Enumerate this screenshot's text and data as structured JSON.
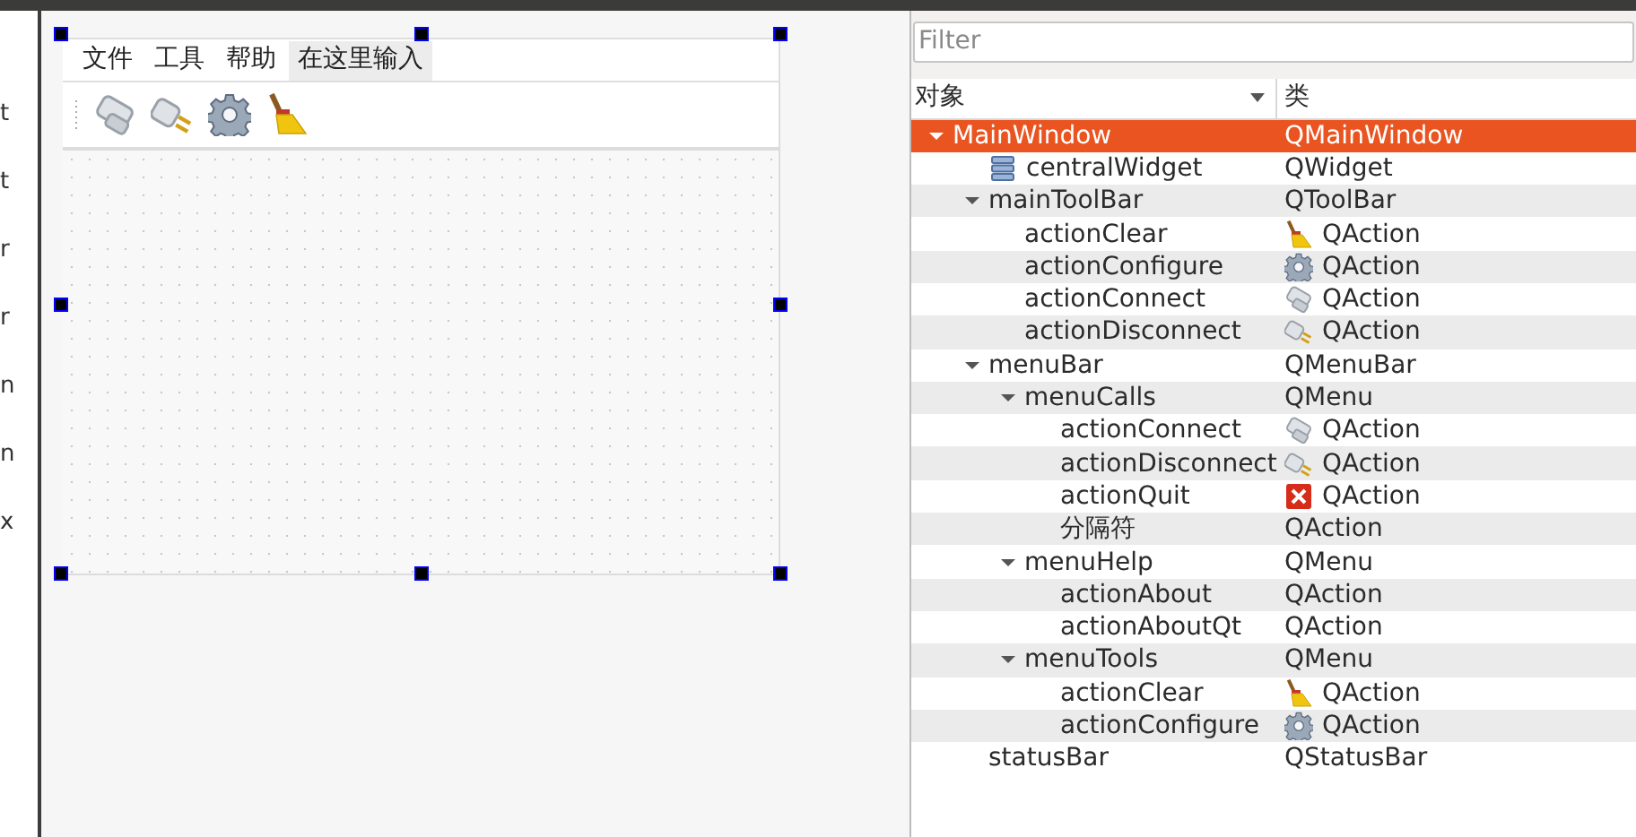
{
  "left_panel": {
    "fragments": [
      "t",
      "t",
      "r",
      "r",
      "n",
      "n",
      "x"
    ]
  },
  "form": {
    "menu_items": [
      {
        "label": "文件",
        "kind": "menu"
      },
      {
        "label": "工具",
        "kind": "menu"
      },
      {
        "label": "帮助",
        "kind": "menu"
      },
      {
        "label": "在这里输入",
        "kind": "placeholder"
      }
    ],
    "toolbar_actions": [
      {
        "kind": "connect"
      },
      {
        "kind": "disconnect"
      },
      {
        "kind": "configure"
      },
      {
        "kind": "clear"
      }
    ]
  },
  "object_inspector": {
    "filter": {
      "placeholder": "Filter"
    },
    "columns": [
      "对象",
      "类"
    ],
    "tree": [
      {
        "name": "MainWindow",
        "class": "QMainWindow",
        "selected": true,
        "expanded": true,
        "children": [
          {
            "name": "centralWidget",
            "name_icon": {
              "kind": "widget"
            },
            "class": "QWidget",
            "selected": false
          },
          {
            "name": "mainToolBar",
            "class": "QToolBar",
            "selected": false,
            "expanded": true,
            "children": [
              {
                "name": "actionClear",
                "class": "QAction",
                "class_icon": {
                  "kind": "clear"
                },
                "selected": false
              },
              {
                "name": "actionConfigure",
                "class": "QAction",
                "class_icon": {
                  "kind": "configure"
                },
                "selected": false
              },
              {
                "name": "actionConnect",
                "class": "QAction",
                "class_icon": {
                  "kind": "connect"
                },
                "selected": false
              },
              {
                "name": "actionDisconnect",
                "class": "QAction",
                "class_icon": {
                  "kind": "disconnect"
                },
                "selected": false
              }
            ]
          },
          {
            "name": "menuBar",
            "class": "QMenuBar",
            "selected": false,
            "expanded": true,
            "children": [
              {
                "name": "menuCalls",
                "class": "QMenu",
                "selected": false,
                "expanded": true,
                "children": [
                  {
                    "name": "actionConnect",
                    "class": "QAction",
                    "class_icon": {
                      "kind": "connect"
                    },
                    "selected": false
                  },
                  {
                    "name": "actionDisconnect",
                    "class": "QAction",
                    "class_icon": {
                      "kind": "disconnect"
                    },
                    "selected": false
                  },
                  {
                    "name": "actionQuit",
                    "class": "QAction",
                    "class_icon": {
                      "kind": "quit"
                    },
                    "selected": false
                  },
                  {
                    "name": "分隔符",
                    "class": "QAction",
                    "selected": false
                  }
                ]
              },
              {
                "name": "menuHelp",
                "class": "QMenu",
                "selected": false,
                "expanded": true,
                "children": [
                  {
                    "name": "actionAbout",
                    "class": "QAction",
                    "selected": false
                  },
                  {
                    "name": "actionAboutQt",
                    "class": "QAction",
                    "selected": false
                  }
                ]
              },
              {
                "name": "menuTools",
                "class": "QMenu",
                "selected": false,
                "expanded": true,
                "children": [
                  {
                    "name": "actionClear",
                    "class": "QAction",
                    "class_icon": {
                      "kind": "clear"
                    },
                    "selected": false
                  },
                  {
                    "name": "actionConfigure",
                    "class": "QAction",
                    "class_icon": {
                      "kind": "configure"
                    },
                    "selected": false
                  }
                ]
              }
            ]
          },
          {
            "name": "statusBar",
            "class": "QStatusBar",
            "selected": false
          }
        ]
      }
    ]
  }
}
